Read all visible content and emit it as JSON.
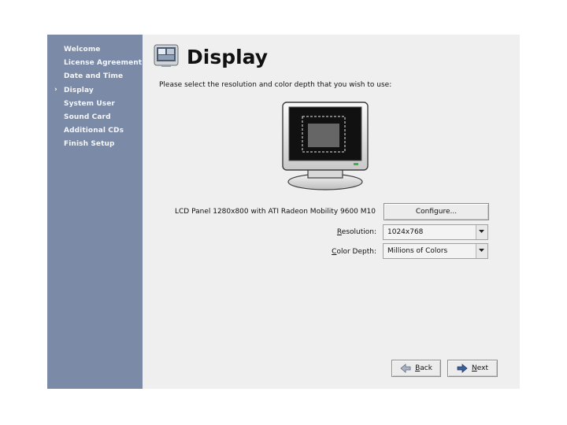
{
  "sidebar": {
    "items": [
      {
        "label": "Welcome"
      },
      {
        "label": "License Agreement"
      },
      {
        "label": "Date and Time"
      },
      {
        "label": "Display",
        "current": true
      },
      {
        "label": "System User"
      },
      {
        "label": "Sound Card"
      },
      {
        "label": "Additional CDs"
      },
      {
        "label": "Finish Setup"
      }
    ],
    "current_marker": "›"
  },
  "header": {
    "title": "Display",
    "icon": "display-settings-icon"
  },
  "instruction": "Please select the resolution and color depth that you wish to use:",
  "monitor": {
    "icon": "monitor-preview-icon"
  },
  "adapter": {
    "label": "LCD Panel 1280x800 with ATI Radeon Mobility 9600 M10",
    "configure_label": "Configure..."
  },
  "resolution": {
    "label_pre": "",
    "label_mnemonic": "R",
    "label_post": "esolution:",
    "value": "1024x768"
  },
  "color_depth": {
    "label_pre": "",
    "label_mnemonic": "C",
    "label_post": "olor Depth:",
    "value": "Millions of Colors"
  },
  "nav": {
    "back_mnemonic": "B",
    "back_rest": "ack",
    "next_mnemonic": "N",
    "next_rest": "ext"
  },
  "colors": {
    "sidebar_bg": "#7b8ba7",
    "window_bg": "#efefef",
    "next_arrow": "#3a5f9a"
  }
}
